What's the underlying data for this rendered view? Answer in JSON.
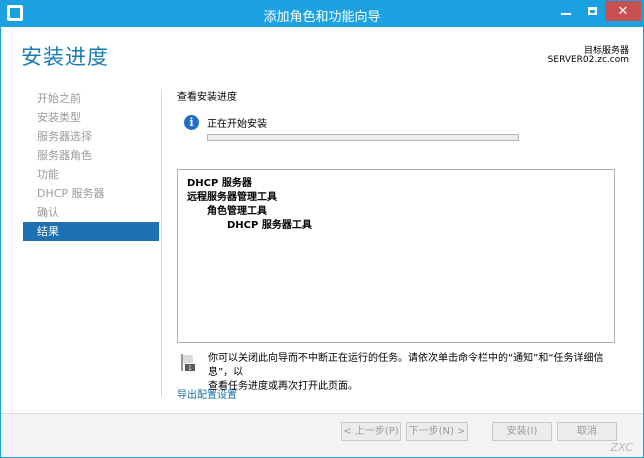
{
  "window": {
    "title": "添加角色和功能向导"
  },
  "header": {
    "page_title": "安装进度",
    "destination_label": "目标服务器",
    "destination_server": "SERVER02.zc.com"
  },
  "nav": {
    "items": [
      {
        "label": "开始之前"
      },
      {
        "label": "安装类型"
      },
      {
        "label": "服务器选择"
      },
      {
        "label": "服务器角色"
      },
      {
        "label": "功能"
      },
      {
        "label": "DHCP 服务器"
      },
      {
        "label": "确认"
      },
      {
        "label": "结果"
      }
    ],
    "active_index": 7
  },
  "main": {
    "section_label": "查看安装进度",
    "status_text": "正在开始安装",
    "progress_fraction": 0.0,
    "results": [
      {
        "text": "DHCP 服务器",
        "level": 0
      },
      {
        "text": "远程服务器管理工具",
        "level": 0
      },
      {
        "text": "角色管理工具",
        "level": 1
      },
      {
        "text": "DHCP 服务器工具",
        "level": 2
      }
    ],
    "note_line1": "你可以关闭此向导而不中断正在运行的任务。请依次单击命令栏中的“通知”和“任务详细信息”，以",
    "note_line2": "查看任务进度或再次打开此页面。",
    "export_link": "导出配置设置"
  },
  "footer": {
    "prev_label": "< 上一步(P)",
    "next_label": "下一步(N) >",
    "install_label": "安装(I)",
    "cancel_label": "取消"
  },
  "watermark": "ZXC",
  "colors": {
    "titlebar": "#1ba1e2",
    "accent": "#1a7bb5",
    "nav_active": "#1f6fb3",
    "close_button": "#c75050"
  },
  "icons": {
    "app": "server-manager-icon",
    "info": "info-icon",
    "note": "flag-note-icon"
  }
}
